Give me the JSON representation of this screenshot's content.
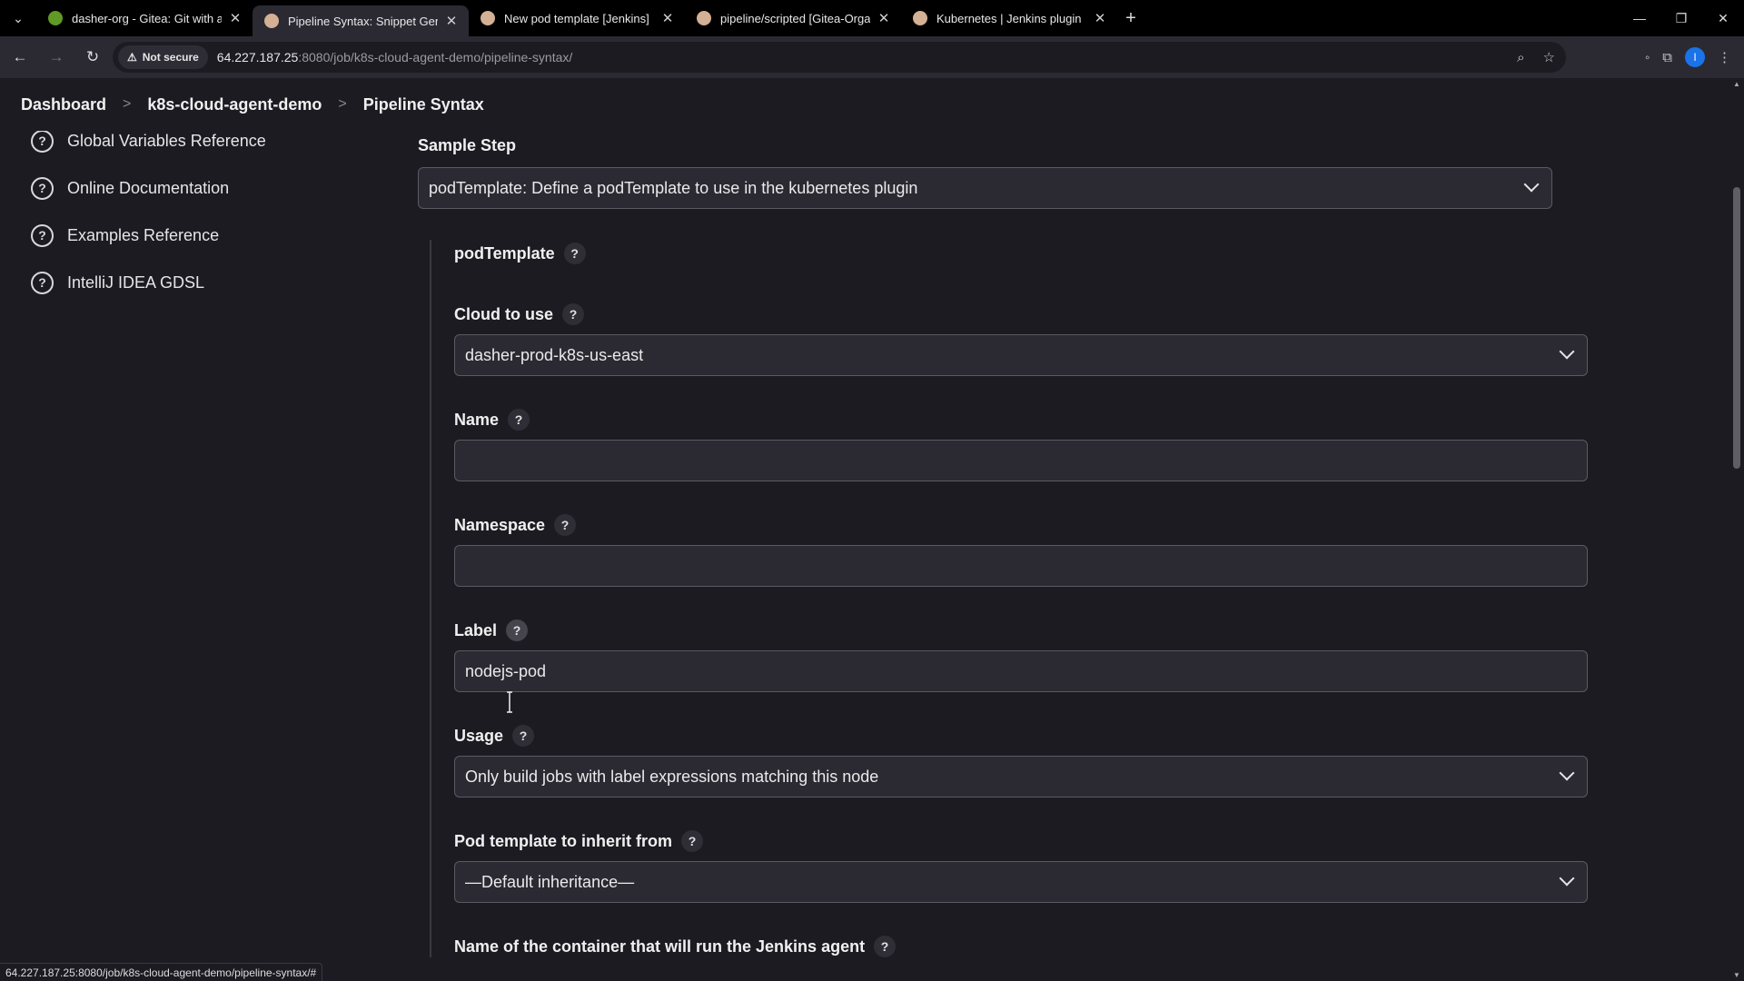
{
  "browser": {
    "tabs": [
      {
        "title": "dasher-org - Gitea: Git with a cup of tea",
        "favicon_color": "#609926",
        "active": false
      },
      {
        "title": "Pipeline Syntax: Snippet Generator",
        "favicon_color": "#d4b094",
        "active": true
      },
      {
        "title": "New pod template [Jenkins]",
        "favicon_color": "#d4b094",
        "active": false
      },
      {
        "title": "pipeline/scripted [Gitea-Organization]",
        "favicon_color": "#d4b094",
        "active": false
      },
      {
        "title": "Kubernetes | Jenkins plugin",
        "favicon_color": "#d4b094",
        "active": false
      }
    ],
    "security_label": "Not secure",
    "url_host": "64.227.187.25",
    "url_path": ":8080/job/k8s-cloud-agent-demo/pipeline-syntax/",
    "profile_initial": "I"
  },
  "breadcrumbs": [
    "Dashboard",
    "k8s-cloud-agent-demo",
    "Pipeline Syntax"
  ],
  "sidebar": {
    "items": [
      {
        "label": "Global Variables Reference"
      },
      {
        "label": "Online Documentation"
      },
      {
        "label": "Examples Reference"
      },
      {
        "label": "IntelliJ IDEA GDSL"
      }
    ]
  },
  "main": {
    "sample_step_label": "Sample Step",
    "sample_step_value": "podTemplate: Define a podTemplate to use in the kubernetes plugin",
    "form_title": "podTemplate",
    "fields": {
      "cloud": {
        "label": "Cloud to use",
        "value": "dasher-prod-k8s-us-east"
      },
      "name": {
        "label": "Name",
        "value": ""
      },
      "namespace": {
        "label": "Namespace",
        "value": ""
      },
      "label": {
        "label": "Label",
        "value": "nodejs-pod"
      },
      "usage": {
        "label": "Usage",
        "value": "Only build jobs with label expressions matching this node"
      },
      "inherit": {
        "label": "Pod template to inherit from",
        "value": "—Default inheritance—"
      },
      "container": {
        "label": "Name of the container that will run the Jenkins agent"
      }
    },
    "help_glyph": "?"
  },
  "status_url": "64.227.187.25:8080/job/k8s-cloud-agent-demo/pipeline-syntax/#"
}
